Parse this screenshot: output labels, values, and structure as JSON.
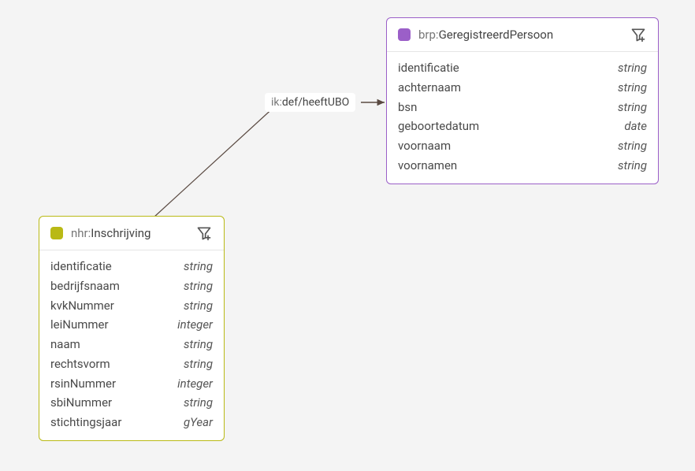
{
  "nodes": {
    "nhr": {
      "prefix": "nhr:",
      "name": "Inschrijving",
      "attrs": [
        {
          "name": "identificatie",
          "type": "string"
        },
        {
          "name": "bedrijfsnaam",
          "type": "string"
        },
        {
          "name": "kvkNummer",
          "type": "string"
        },
        {
          "name": "leiNummer",
          "type": "integer"
        },
        {
          "name": "naam",
          "type": "string"
        },
        {
          "name": "rechtsvorm",
          "type": "string"
        },
        {
          "name": "rsinNummer",
          "type": "integer"
        },
        {
          "name": "sbiNummer",
          "type": "string"
        },
        {
          "name": "stichtingsjaar",
          "type": "gYear"
        }
      ]
    },
    "brp": {
      "prefix": "brp:",
      "name": "GeregistreerdPersoon",
      "attrs": [
        {
          "name": "identificatie",
          "type": "string"
        },
        {
          "name": "achternaam",
          "type": "string"
        },
        {
          "name": "bsn",
          "type": "string"
        },
        {
          "name": "geboortedatum",
          "type": "date"
        },
        {
          "name": "voornaam",
          "type": "string"
        },
        {
          "name": "voornamen",
          "type": "string"
        }
      ]
    }
  },
  "edge": {
    "prefix": "ik:",
    "name": "def/heeftUBO"
  }
}
